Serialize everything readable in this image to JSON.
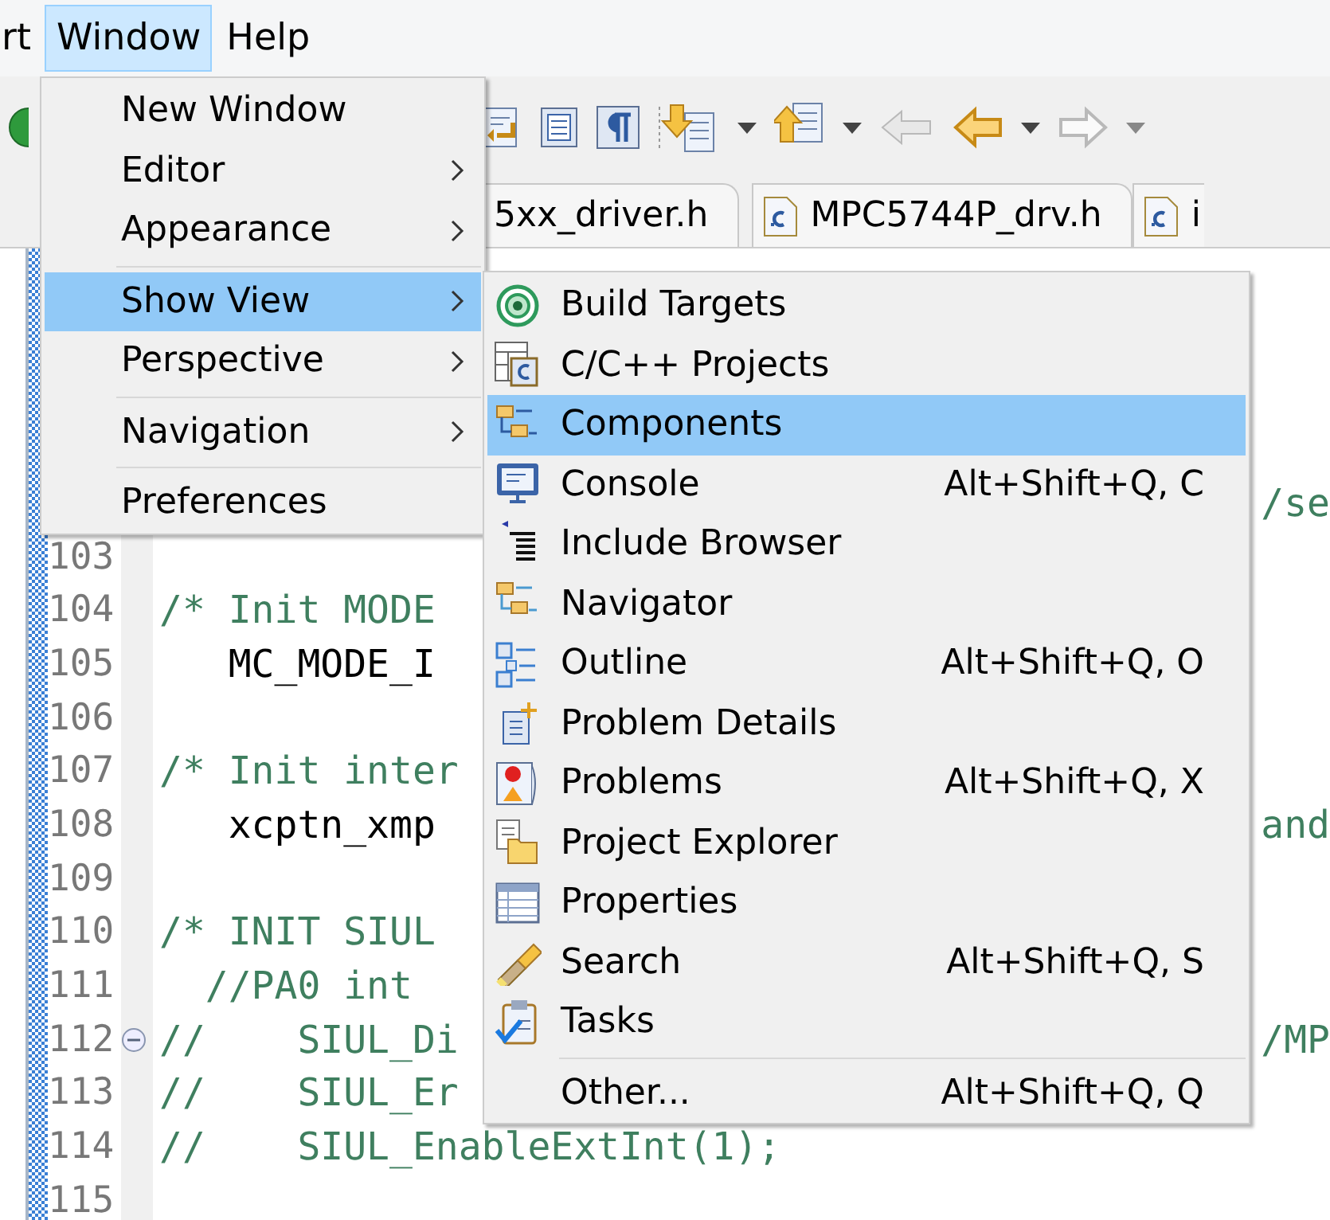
{
  "menubar": [
    {
      "label": "rt",
      "selected": false
    },
    {
      "label": "Window",
      "selected": true
    },
    {
      "label": "Help",
      "selected": false
    }
  ],
  "editor_tabs": [
    {
      "label": "5xx_driver.h",
      "icon": false
    },
    {
      "label": "MPC5744P_drv.h",
      "icon": true
    },
    {
      "label": "i",
      "icon": true
    }
  ],
  "window_menu": [
    {
      "kind": "item",
      "label": "New Window",
      "submenu": false,
      "selected": false
    },
    {
      "kind": "item",
      "label": "Editor",
      "submenu": true,
      "selected": false
    },
    {
      "kind": "item",
      "label": "Appearance",
      "submenu": true,
      "selected": false
    },
    {
      "kind": "separator"
    },
    {
      "kind": "item",
      "label": "Show View",
      "submenu": true,
      "selected": true
    },
    {
      "kind": "item",
      "label": "Perspective",
      "submenu": true,
      "selected": false
    },
    {
      "kind": "separator"
    },
    {
      "kind": "item",
      "label": "Navigation",
      "submenu": true,
      "selected": false
    },
    {
      "kind": "separator"
    },
    {
      "kind": "item",
      "label": "Preferences",
      "submenu": false,
      "selected": false
    }
  ],
  "show_view_menu": [
    {
      "kind": "item",
      "label": "Build Targets",
      "selected": false
    },
    {
      "kind": "item",
      "label": "C/C++ Projects",
      "selected": false
    },
    {
      "kind": "item",
      "label": "Components",
      "selected": true
    },
    {
      "kind": "item",
      "label": "Console",
      "shortcut": "Alt+Shift+Q, C",
      "selected": false
    },
    {
      "kind": "item",
      "label": "Include Browser",
      "selected": false
    },
    {
      "kind": "item",
      "label": "Navigator",
      "selected": false
    },
    {
      "kind": "item",
      "label": "Outline",
      "shortcut": "Alt+Shift+Q, O",
      "selected": false
    },
    {
      "kind": "item",
      "label": "Problem Details",
      "selected": false
    },
    {
      "kind": "item",
      "label": "Problems",
      "shortcut": "Alt+Shift+Q, X",
      "selected": false
    },
    {
      "kind": "item",
      "label": "Project Explorer",
      "selected": false
    },
    {
      "kind": "item",
      "label": "Properties",
      "selected": false
    },
    {
      "kind": "item",
      "label": "Search",
      "shortcut": "Alt+Shift+Q, S",
      "selected": false
    },
    {
      "kind": "item",
      "label": "Tasks",
      "selected": false
    },
    {
      "kind": "separator"
    },
    {
      "kind": "item",
      "label": "Other...",
      "shortcut": "Alt+Shift+Q, Q",
      "selected": false
    }
  ],
  "code_lines": [
    {
      "right": {
        "text": "/se",
        "kind": "comment"
      }
    },
    {
      "number": "103"
    },
    {
      "number": "104",
      "text": "/* Init MODE",
      "kind": "comment"
    },
    {
      "number": "105",
      "text": "   MC_MODE_I",
      "kind": "code"
    },
    {
      "number": "106"
    },
    {
      "number": "107",
      "text": "/* Init inter",
      "kind": "comment"
    },
    {
      "number": "108",
      "text": "   xcptn_xmp",
      "kind": "code",
      "right": {
        "text": "and",
        "kind": "comment"
      }
    },
    {
      "number": "109"
    },
    {
      "number": "110",
      "text": "/* INIT SIUL",
      "kind": "comment"
    },
    {
      "number": "111",
      "text": "  //PA0 int",
      "kind": "comment"
    },
    {
      "number": "112",
      "text": "//    SIUL_Di",
      "kind": "comment",
      "fold_marker": true,
      "right": {
        "text": "/MP",
        "kind": "comment"
      }
    },
    {
      "number": "113",
      "text": "//    SIUL_Er",
      "kind": "comment"
    },
    {
      "number": "114",
      "text": "//    SIUL_EnableExtInt(1);",
      "kind": "comment"
    },
    {
      "number": "115"
    }
  ]
}
